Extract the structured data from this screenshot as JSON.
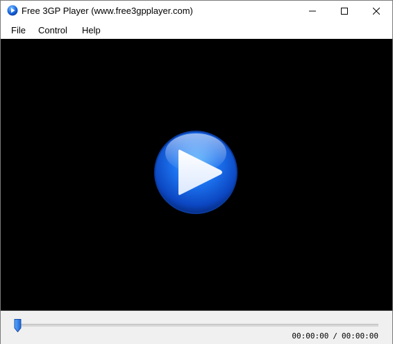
{
  "window": {
    "title": "Free 3GP Player (www.free3gpplayer.com)",
    "app_icon": "play-icon",
    "controls": [
      "minimize-icon",
      "maximize-icon",
      "close-icon"
    ]
  },
  "menu": {
    "items": [
      {
        "label": "File"
      },
      {
        "label": "Control"
      },
      {
        "label": "Help"
      }
    ]
  },
  "player": {
    "play_icon": "play-icon",
    "current_time": "00:00:00",
    "separator": "/",
    "total_time": "00:00:00",
    "seek_position": 0
  },
  "colors": {
    "video_background": "#000000",
    "play_button_blue": "#1e6fe8",
    "panel_background": "#f0f0f0"
  }
}
